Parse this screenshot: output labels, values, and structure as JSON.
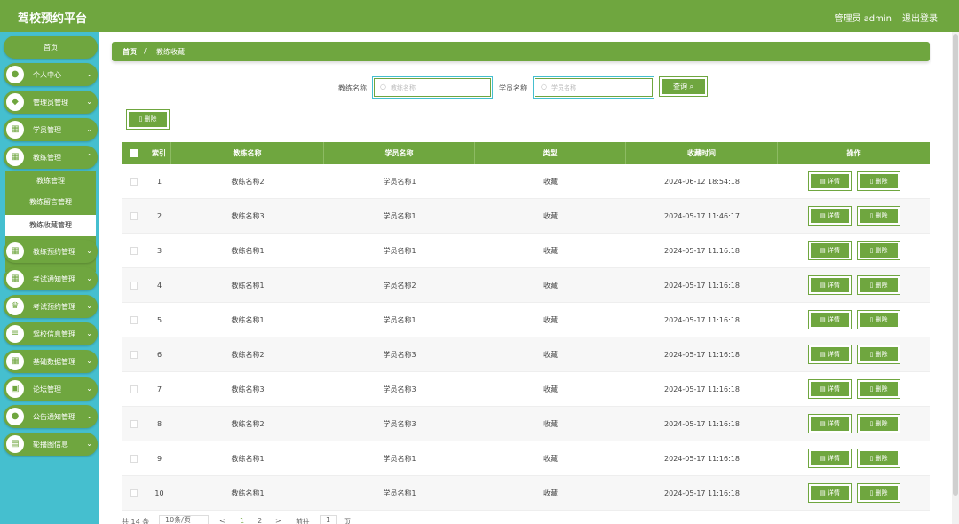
{
  "app": {
    "title": "驾校预约平台",
    "user": "管理员 admin",
    "logout": "退出登录"
  },
  "sidebar": {
    "items": [
      {
        "label": "首页",
        "icon": "home"
      },
      {
        "label": "个人中心",
        "icon": "user-icon"
      },
      {
        "label": "管理员管理",
        "icon": "admin-icon"
      },
      {
        "label": "学员管理",
        "icon": "grid-icon"
      },
      {
        "label": "教练管理",
        "icon": "grid-icon"
      },
      {
        "label": "教练预约管理",
        "icon": "grid-icon"
      },
      {
        "label": "考试通知管理",
        "icon": "grid-icon"
      },
      {
        "label": "考试预约管理",
        "icon": "trophy-icon"
      },
      {
        "label": "驾校信息管理",
        "icon": "list-icon"
      },
      {
        "label": "基础数据管理",
        "icon": "grid-icon"
      },
      {
        "label": "论坛管理",
        "icon": "briefcase-icon"
      },
      {
        "label": "公告通知管理",
        "icon": "user-icon"
      },
      {
        "label": "轮播图信息",
        "icon": "image-icon"
      }
    ],
    "submenu": [
      "教练管理",
      "教练留言管理",
      "教练收藏管理"
    ]
  },
  "breadcrumb": {
    "home": "首页",
    "separator": "/",
    "current": "教练收藏"
  },
  "filters": {
    "coach_label": "教练名称",
    "coach_placeholder": "教练名称",
    "student_label": "学员名称",
    "student_placeholder": "学员名称",
    "query_button": "查询"
  },
  "actions": {
    "delete_label": "删除"
  },
  "table": {
    "headers": [
      "索引",
      "教练名称",
      "学员名称",
      "类型",
      "收藏时间",
      "操作"
    ],
    "rows": [
      {
        "index": "1",
        "coach": "教练名称2",
        "student": "学员名称1",
        "type": "收藏",
        "time": "2024-06-12 18:54:18"
      },
      {
        "index": "2",
        "coach": "教练名称3",
        "student": "学员名称1",
        "type": "收藏",
        "time": "2024-05-17 11:46:17"
      },
      {
        "index": "3",
        "coach": "教练名称1",
        "student": "学员名称1",
        "type": "收藏",
        "time": "2024-05-17 11:16:18"
      },
      {
        "index": "4",
        "coach": "教练名称1",
        "student": "学员名称2",
        "type": "收藏",
        "time": "2024-05-17 11:16:18"
      },
      {
        "index": "5",
        "coach": "教练名称1",
        "student": "学员名称1",
        "type": "收藏",
        "time": "2024-05-17 11:16:18"
      },
      {
        "index": "6",
        "coach": "教练名称2",
        "student": "学员名称3",
        "type": "收藏",
        "time": "2024-05-17 11:16:18"
      },
      {
        "index": "7",
        "coach": "教练名称3",
        "student": "学员名称3",
        "type": "收藏",
        "time": "2024-05-17 11:16:18"
      },
      {
        "index": "8",
        "coach": "教练名称2",
        "student": "学员名称3",
        "type": "收藏",
        "time": "2024-05-17 11:16:18"
      },
      {
        "index": "9",
        "coach": "教练名称1",
        "student": "学员名称1",
        "type": "收藏",
        "time": "2024-05-17 11:16:18"
      },
      {
        "index": "10",
        "coach": "教练名称1",
        "student": "学员名称1",
        "type": "收藏",
        "time": "2024-05-17 11:16:18"
      }
    ],
    "detail_label": "详情",
    "delete_label": "删除"
  },
  "pager": {
    "total": "共 14 条",
    "page_size": "10条/页",
    "prev": "<",
    "page1": "1",
    "page2": "2",
    "next": ">",
    "goto": "前往",
    "current": "1",
    "unit": "页"
  },
  "colors": {
    "primary": "#6fa63f",
    "sidebar": "#45bfcf"
  }
}
